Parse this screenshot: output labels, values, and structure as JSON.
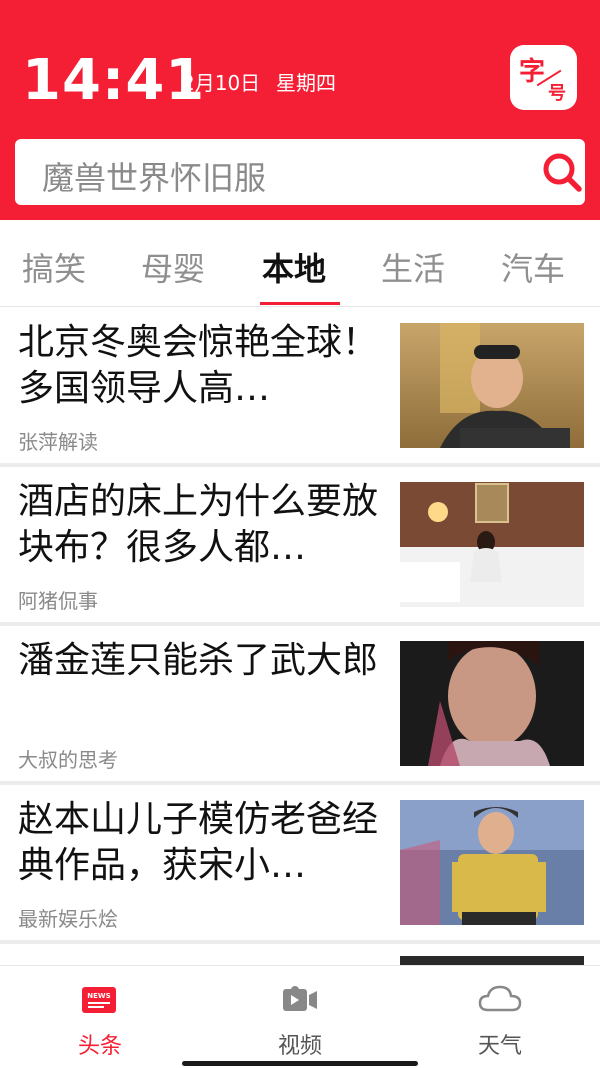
{
  "status": {
    "time": "14:41",
    "date": "2月10日",
    "weekday": "星期四"
  },
  "font_button": {
    "big": "字",
    "small": "号"
  },
  "search": {
    "placeholder": "魔兽世界怀旧服"
  },
  "tabs": [
    {
      "label": "搞笑",
      "active": false
    },
    {
      "label": "母婴",
      "active": false
    },
    {
      "label": "本地",
      "active": true
    },
    {
      "label": "生活",
      "active": false
    },
    {
      "label": "汽车",
      "active": false
    }
  ],
  "feed": [
    {
      "title": "北京冬奥会惊艳全球！多国领导人高…",
      "source": "张萍解读"
    },
    {
      "title": "酒店的床上为什么要放块布？很多人都…",
      "source": "阿猪侃事"
    },
    {
      "title": "潘金莲只能杀了武大郎",
      "source": "大叔的思考"
    },
    {
      "title": "赵本山儿子模仿老爸经典作品，获宋小…",
      "source": "最新娱乐烩"
    }
  ],
  "bottom_nav": [
    {
      "label": "头条",
      "icon": "news-icon",
      "active": true,
      "icon_text": "NEWS"
    },
    {
      "label": "视频",
      "icon": "video-camera-icon",
      "active": false
    },
    {
      "label": "天气",
      "icon": "cloud-icon",
      "active": false
    }
  ],
  "colors": {
    "accent": "#f41f34",
    "divider": "#ececec",
    "muted": "#8a8a8a"
  }
}
